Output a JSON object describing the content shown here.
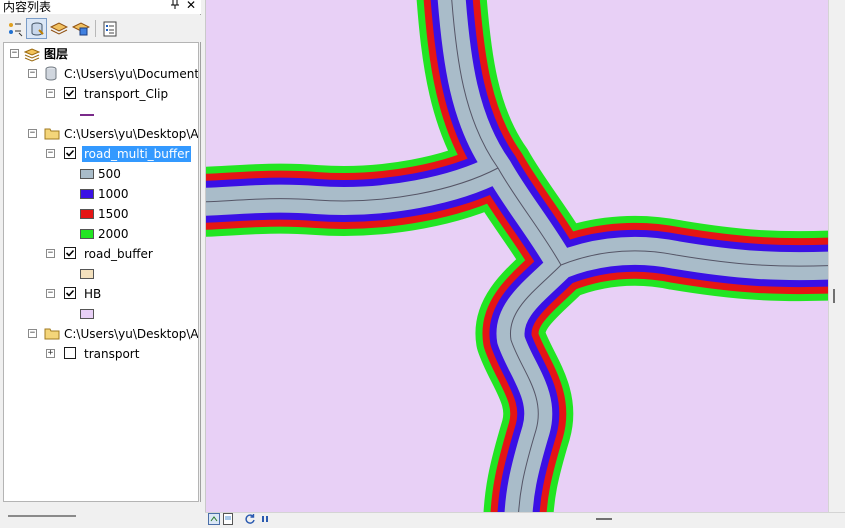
{
  "toc": {
    "title": "内容列表",
    "pin_glyph": "↕",
    "close_glyph": "✕",
    "toolbar": [
      {
        "icon": "list-by-drawing-order-icon"
      },
      {
        "icon": "list-by-source-icon"
      },
      {
        "icon": "list-by-visibility-icon"
      },
      {
        "icon": "list-by-selection-icon"
      },
      {
        "icon": "options-icon"
      }
    ],
    "tree": {
      "root_label": "图层",
      "groups": [
        {
          "path": "C:\\Users\\yu\\Documents",
          "type": "database"
        },
        {
          "path": "C:\\Users\\yu\\Desktop\\A",
          "type": "folder"
        },
        {
          "path": "C:\\Users\\yu\\Desktop\\A",
          "type": "folder"
        }
      ],
      "layers": {
        "transport_clip": {
          "name": "transport_Clip",
          "checked": true,
          "line_color": "#7a2a8a"
        },
        "road_multi_buffer": {
          "name": "road_multi_buffer",
          "checked": true,
          "selected": true,
          "classes": [
            {
              "label": "500",
              "color": "#a9bcc9"
            },
            {
              "label": "1000",
              "color": "#3a10e5"
            },
            {
              "label": "1500",
              "color": "#e51515"
            },
            {
              "label": "2000",
              "color": "#22e522"
            }
          ]
        },
        "road_buffer": {
          "name": "road_buffer",
          "checked": true,
          "color": "#f3e0bd"
        },
        "hb": {
          "name": "HB",
          "checked": true,
          "color": "#e8d0f6"
        },
        "transport": {
          "name": "transport",
          "checked": false
        }
      }
    }
  },
  "map": {
    "background": "#e8d0f6",
    "buffer_colors": {
      "ring_2000": "#22e522",
      "ring_1500": "#e51515",
      "ring_1000": "#3a10e5",
      "ring_500": "#a9bcc9",
      "road_line": "#555566"
    }
  }
}
